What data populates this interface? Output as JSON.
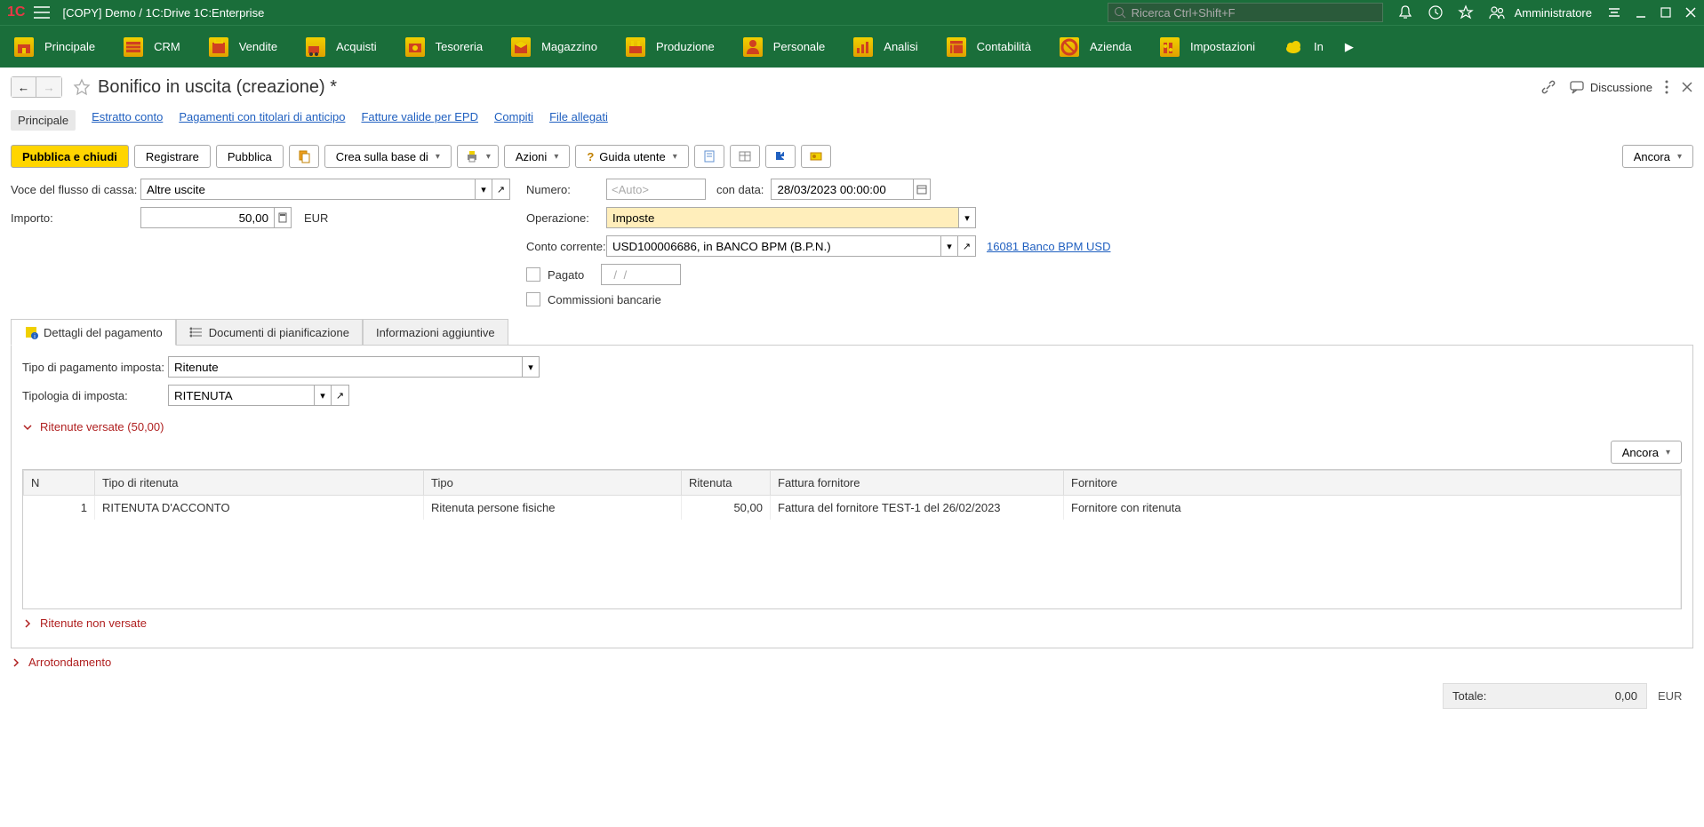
{
  "titlebar": {
    "title": "[COPY] Demo / 1C:Drive 1C:Enterprise",
    "search_placeholder": "Ricerca Ctrl+Shift+F",
    "user": "Amministratore"
  },
  "navbar": {
    "items": [
      {
        "label": "Principale"
      },
      {
        "label": "CRM"
      },
      {
        "label": "Vendite"
      },
      {
        "label": "Acquisti"
      },
      {
        "label": "Tesoreria"
      },
      {
        "label": "Magazzino"
      },
      {
        "label": "Produzione"
      },
      {
        "label": "Personale"
      },
      {
        "label": "Analisi"
      },
      {
        "label": "Contabilità"
      },
      {
        "label": "Azienda"
      },
      {
        "label": "Impostazioni"
      },
      {
        "label": "In"
      }
    ]
  },
  "page": {
    "title": "Bonifico in uscita (creazione) *",
    "discussion": "Discussione"
  },
  "doc_nav": {
    "items": [
      {
        "label": "Principale",
        "active": true
      },
      {
        "label": "Estratto conto"
      },
      {
        "label": "Pagamenti con titolari di anticipo"
      },
      {
        "label": "Fatture valide per EPD"
      },
      {
        "label": "Compiti"
      },
      {
        "label": "File allegati"
      }
    ]
  },
  "toolbar": {
    "post_close": "Pubblica e chiudi",
    "register": "Registrare",
    "post": "Pubblica",
    "create_based": "Crea sulla base di",
    "actions": "Azioni",
    "help": "Guida utente",
    "more": "Ancora"
  },
  "form": {
    "cashflow_label": "Voce del flusso di cassa:",
    "cashflow_value": "Altre uscite",
    "amount_label": "Importo:",
    "amount_value": "50,00",
    "currency": "EUR",
    "number_label": "Numero:",
    "number_placeholder": "<Auto>",
    "date_label": "con data:",
    "date_value": "28/03/2023 00:00:00",
    "operation_label": "Operazione:",
    "operation_value": "Imposte",
    "account_label": "Conto corrente:",
    "account_value": "USD100006686, in BANCO BPM (B.P.N.)",
    "account_link": "16081 Banco BPM USD",
    "paid_label": "Pagato",
    "paid_date": "  /  /    ",
    "commissions_label": "Commissioni bancarie"
  },
  "tabs": {
    "items": [
      {
        "label": "Dettagli del pagamento",
        "active": true
      },
      {
        "label": "Documenti di pianificazione"
      },
      {
        "label": "Informazioni aggiuntive"
      }
    ]
  },
  "payment_details": {
    "tax_payment_type_label": "Tipo di pagamento imposta:",
    "tax_payment_type_value": "Ritenute",
    "tax_type_label": "Tipologia di imposta:",
    "tax_type_value": "RITENUTA",
    "section_paid": "Ritenute versate (50,00)",
    "section_unpaid": "Ritenute non versate",
    "more": "Ancora",
    "grid": {
      "columns": [
        "N",
        "Tipo di ritenuta",
        "Tipo",
        "Ritenuta",
        "Fattura fornitore",
        "Fornitore"
      ],
      "widths": [
        "80px",
        "370px",
        "290px",
        "100px",
        "330px",
        "auto"
      ],
      "rows": [
        {
          "n": "1",
          "withholding_type": "RITENUTA D'ACCONTO",
          "type": "Ritenuta persone fisiche",
          "amount": "50,00",
          "invoice": "Fattura del fornitore TEST-1 del 26/02/2023",
          "supplier": "Fornitore con ritenuta"
        }
      ]
    }
  },
  "rounding": {
    "label": "Arrotondamento"
  },
  "totals": {
    "label": "Totale:",
    "value": "0,00",
    "currency": "EUR"
  }
}
